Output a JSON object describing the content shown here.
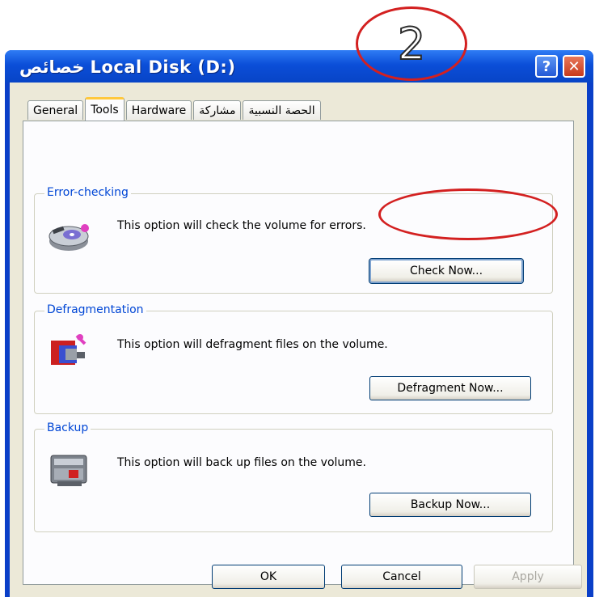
{
  "annotation": {
    "step_number": "2"
  },
  "window": {
    "title": "خصائص  Local Disk (D:)",
    "help_label": "?",
    "close_label": "✕"
  },
  "tabs": [
    {
      "label": "General"
    },
    {
      "label": "Tools",
      "active": true
    },
    {
      "label": "Hardware"
    },
    {
      "label": "مشاركة"
    },
    {
      "label": "الحصة النسبية"
    }
  ],
  "error_checking": {
    "legend": "Error-checking",
    "description": "This option will check the volume for errors.",
    "button_label": "Check Now..."
  },
  "defragmentation": {
    "legend": "Defragmentation",
    "description": "This option will defragment files on the volume.",
    "button_label": "Defragment Now..."
  },
  "backup": {
    "legend": "Backup",
    "description": "This option will back up files on the volume.",
    "button_label": "Backup Now..."
  },
  "footer": {
    "ok_label": "OK",
    "cancel_label": "Cancel",
    "apply_label": "Apply"
  },
  "colors": {
    "titlebar": "#0b4ed8",
    "legend": "#0046d5",
    "annotation": "#d32020",
    "dialog_bg": "#ece9d8"
  },
  "icons": [
    "disk-check-icon",
    "defragment-icon",
    "backup-icon",
    "help-icon",
    "close-icon"
  ]
}
